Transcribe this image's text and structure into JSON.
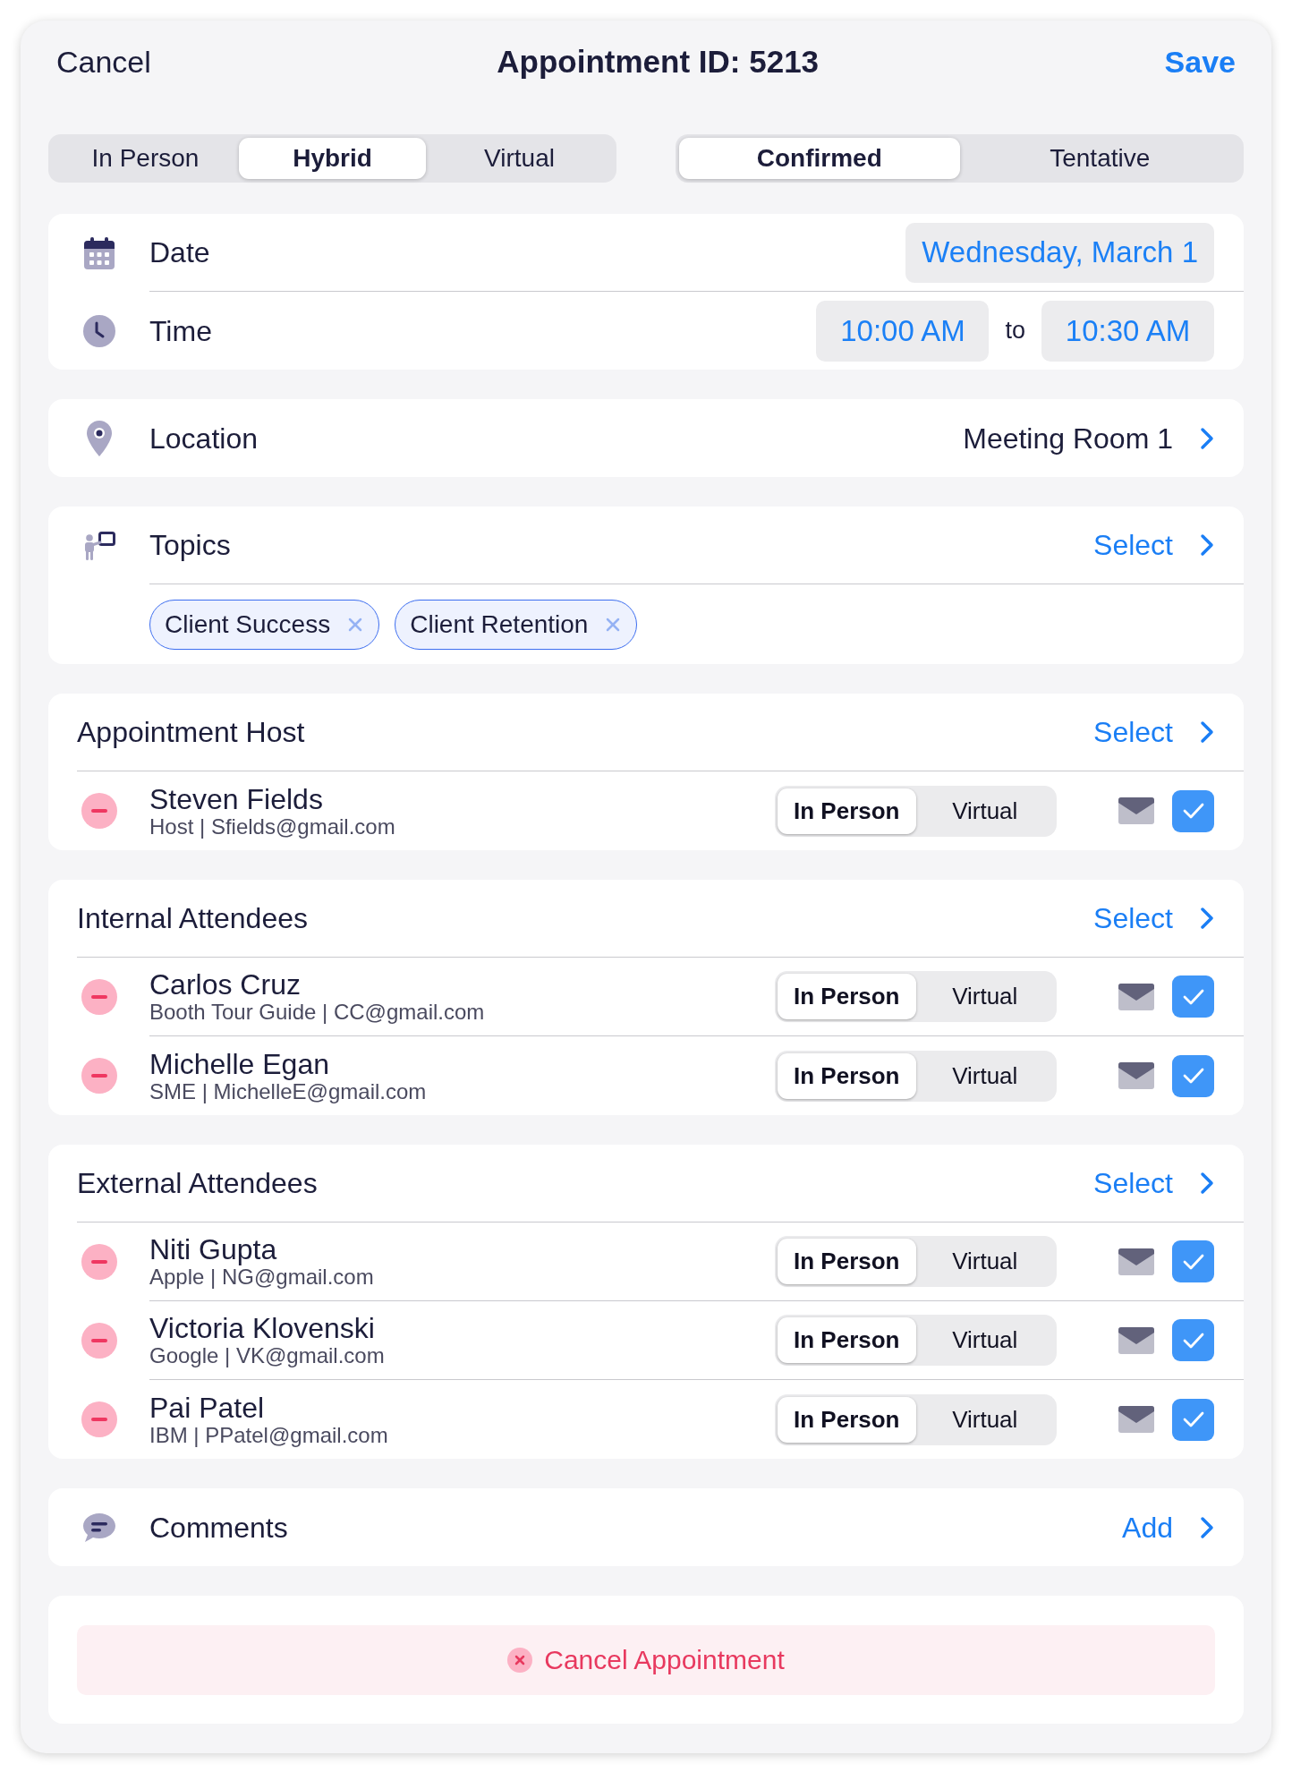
{
  "header": {
    "cancel": "Cancel",
    "title": "Appointment ID: 5213",
    "save": "Save"
  },
  "mode_tabs": [
    {
      "label": "In Person",
      "selected": false
    },
    {
      "label": "Hybrid",
      "selected": true
    },
    {
      "label": "Virtual",
      "selected": false
    }
  ],
  "status_tabs": [
    {
      "label": "Confirmed",
      "selected": true
    },
    {
      "label": "Tentative",
      "selected": false
    }
  ],
  "schedule": {
    "date_label": "Date",
    "date": "Wednesday, March 1",
    "time_label": "Time",
    "start_time": "10:00 AM",
    "separator": "to",
    "end_time": "10:30 AM"
  },
  "location": {
    "label": "Location",
    "value": "Meeting Room 1"
  },
  "topics": {
    "label": "Topics",
    "action": "Select",
    "chips": [
      "Client Success",
      "Client Retention"
    ]
  },
  "groups": [
    {
      "title": "Appointment Host",
      "action": "Select",
      "people": [
        {
          "name": "Steven Fields",
          "detail": "Host | Sfields@gmail.com",
          "attendance": [
            {
              "label": "In Person",
              "selected": true
            },
            {
              "label": "Virtual",
              "selected": false
            }
          ],
          "checked": true
        }
      ]
    },
    {
      "title": "Internal Attendees",
      "action": "Select",
      "people": [
        {
          "name": "Carlos Cruz",
          "detail": "Booth Tour Guide | CC@gmail.com",
          "attendance": [
            {
              "label": "In Person",
              "selected": true
            },
            {
              "label": "Virtual",
              "selected": false
            }
          ],
          "checked": true
        },
        {
          "name": "Michelle Egan",
          "detail": "SME | MichelleE@gmail.com",
          "attendance": [
            {
              "label": "In Person",
              "selected": true
            },
            {
              "label": "Virtual",
              "selected": false
            }
          ],
          "checked": true
        }
      ]
    },
    {
      "title": "External Attendees",
      "action": "Select",
      "people": [
        {
          "name": "Niti Gupta",
          "detail": "Apple | NG@gmail.com",
          "attendance": [
            {
              "label": "In Person",
              "selected": true
            },
            {
              "label": "Virtual",
              "selected": false
            }
          ],
          "checked": true
        },
        {
          "name": "Victoria Klovenski",
          "detail": "Google | VK@gmail.com",
          "attendance": [
            {
              "label": "In Person",
              "selected": true
            },
            {
              "label": "Virtual",
              "selected": false
            }
          ],
          "checked": true
        },
        {
          "name": "Pai Patel",
          "detail": "IBM | PPatel@gmail.com",
          "attendance": [
            {
              "label": "In Person",
              "selected": true
            },
            {
              "label": "Virtual",
              "selected": false
            }
          ],
          "checked": true
        }
      ]
    }
  ],
  "comments": {
    "label": "Comments",
    "action": "Add"
  },
  "cancel_appointment": {
    "label": "Cancel Appointment"
  }
}
